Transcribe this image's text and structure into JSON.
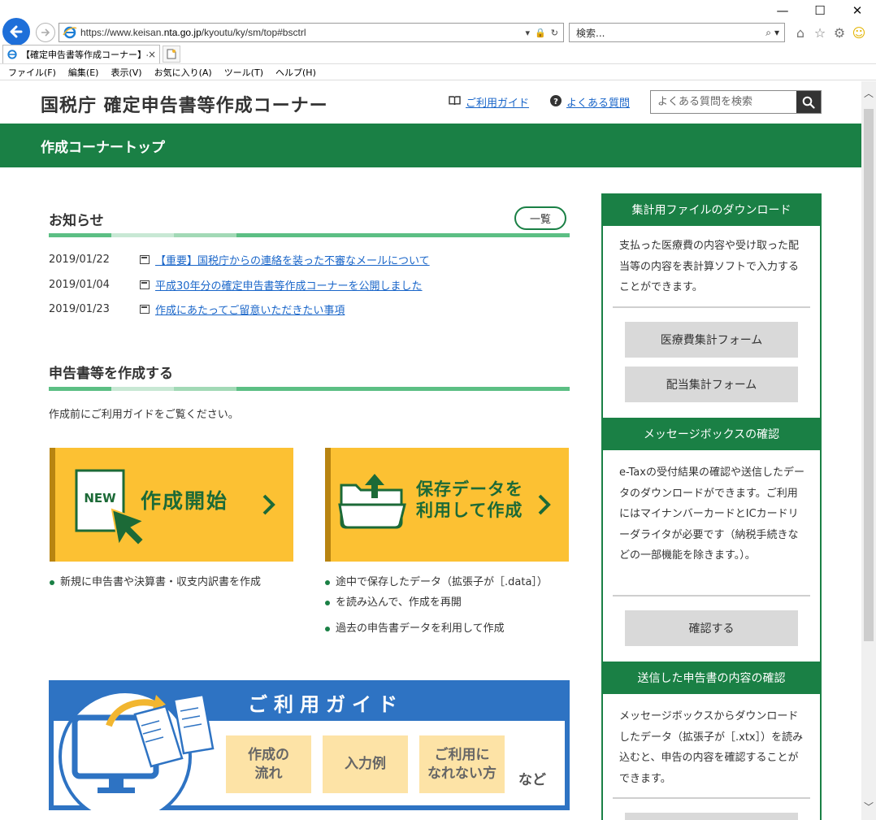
{
  "browser": {
    "url_prefix": "https://www.keisan.",
    "url_domain": "nta.go.jp",
    "url_path": "/kyoutu/ky/sm/top#bsctrl",
    "search_placeholder": "検索...",
    "tab_title": "【確定申告書等作成コーナー】-...",
    "tab_close": "×",
    "menu": [
      "ファイル(F)",
      "編集(E)",
      "表示(V)",
      "お気に入り(A)",
      "ツール(T)",
      "ヘルプ(H)"
    ]
  },
  "header": {
    "site_title": "国税庁 確定申告書等作成コーナー",
    "guide_link": "ご利用ガイド",
    "faq_link": "よくある質問",
    "faq_search_placeholder": "よくある質問を検索"
  },
  "green_bar": {
    "label": "作成コーナートップ"
  },
  "news": {
    "title": "お知らせ",
    "list_button": "一覧",
    "items": [
      {
        "date": "2019/01/22",
        "text": "【重要】国税庁からの連絡を装った不審なメールについて"
      },
      {
        "date": "2019/01/04",
        "text": "平成30年分の確定申告書等作成コーナーを公開しました"
      },
      {
        "date": "2019/01/23",
        "text": "作成にあたってご留意いただきたい事項"
      }
    ]
  },
  "create": {
    "title": "申告書等を作成する",
    "intro": "作成前にご利用ガイドをご覧ください。",
    "start_new_badge": "NEW",
    "start_label": "作成開始",
    "saved_label_1": "保存データを",
    "saved_label_2": "利用して作成",
    "start_bullets": [
      "新規に申告書や決算書・収支内訳書を作成"
    ],
    "saved_bullets": [
      "途中で保存したデータ（拡張子が［.data］）",
      "を読み込んで、作成を再開",
      "過去の申告書データを利用して作成"
    ]
  },
  "guide": {
    "title": "ご利用ガイド",
    "chip1_line1": "作成の",
    "chip1_line2": "流れ",
    "chip2": "入力例",
    "chip3_line1": "ご利用に",
    "chip3_line2": "なれない方",
    "etc": "など"
  },
  "sidebar": {
    "download_head": "集計用ファイルのダウンロード",
    "download_text": "支払った医療費の内容や受け取った配当等の内容を表計算ソフトで入力することができます。",
    "medical_button": "医療費集計フォーム",
    "dividend_button": "配当集計フォーム",
    "msgbox_head": "メッセージボックスの確認",
    "msgbox_text": "e-Taxの受付結果の確認や送信したデータのダウンロードができます。ご利用にはマイナンバーカードとICカードリーダライタが必要です（納税手続きなどの一部機能を除きます。）。",
    "confirm_button": "確認する",
    "sent_head": "送信した申告書の内容の確認",
    "sent_text": "メッセージボックスからダウンロードしたデータ（拡張子が［.xtx］）を読み込むと、申告の内容を確認することができます。"
  },
  "colors": {
    "green": "#1a8045",
    "yellow": "#fcc133",
    "blue": "#2e73c3",
    "link": "#1a66c9"
  }
}
